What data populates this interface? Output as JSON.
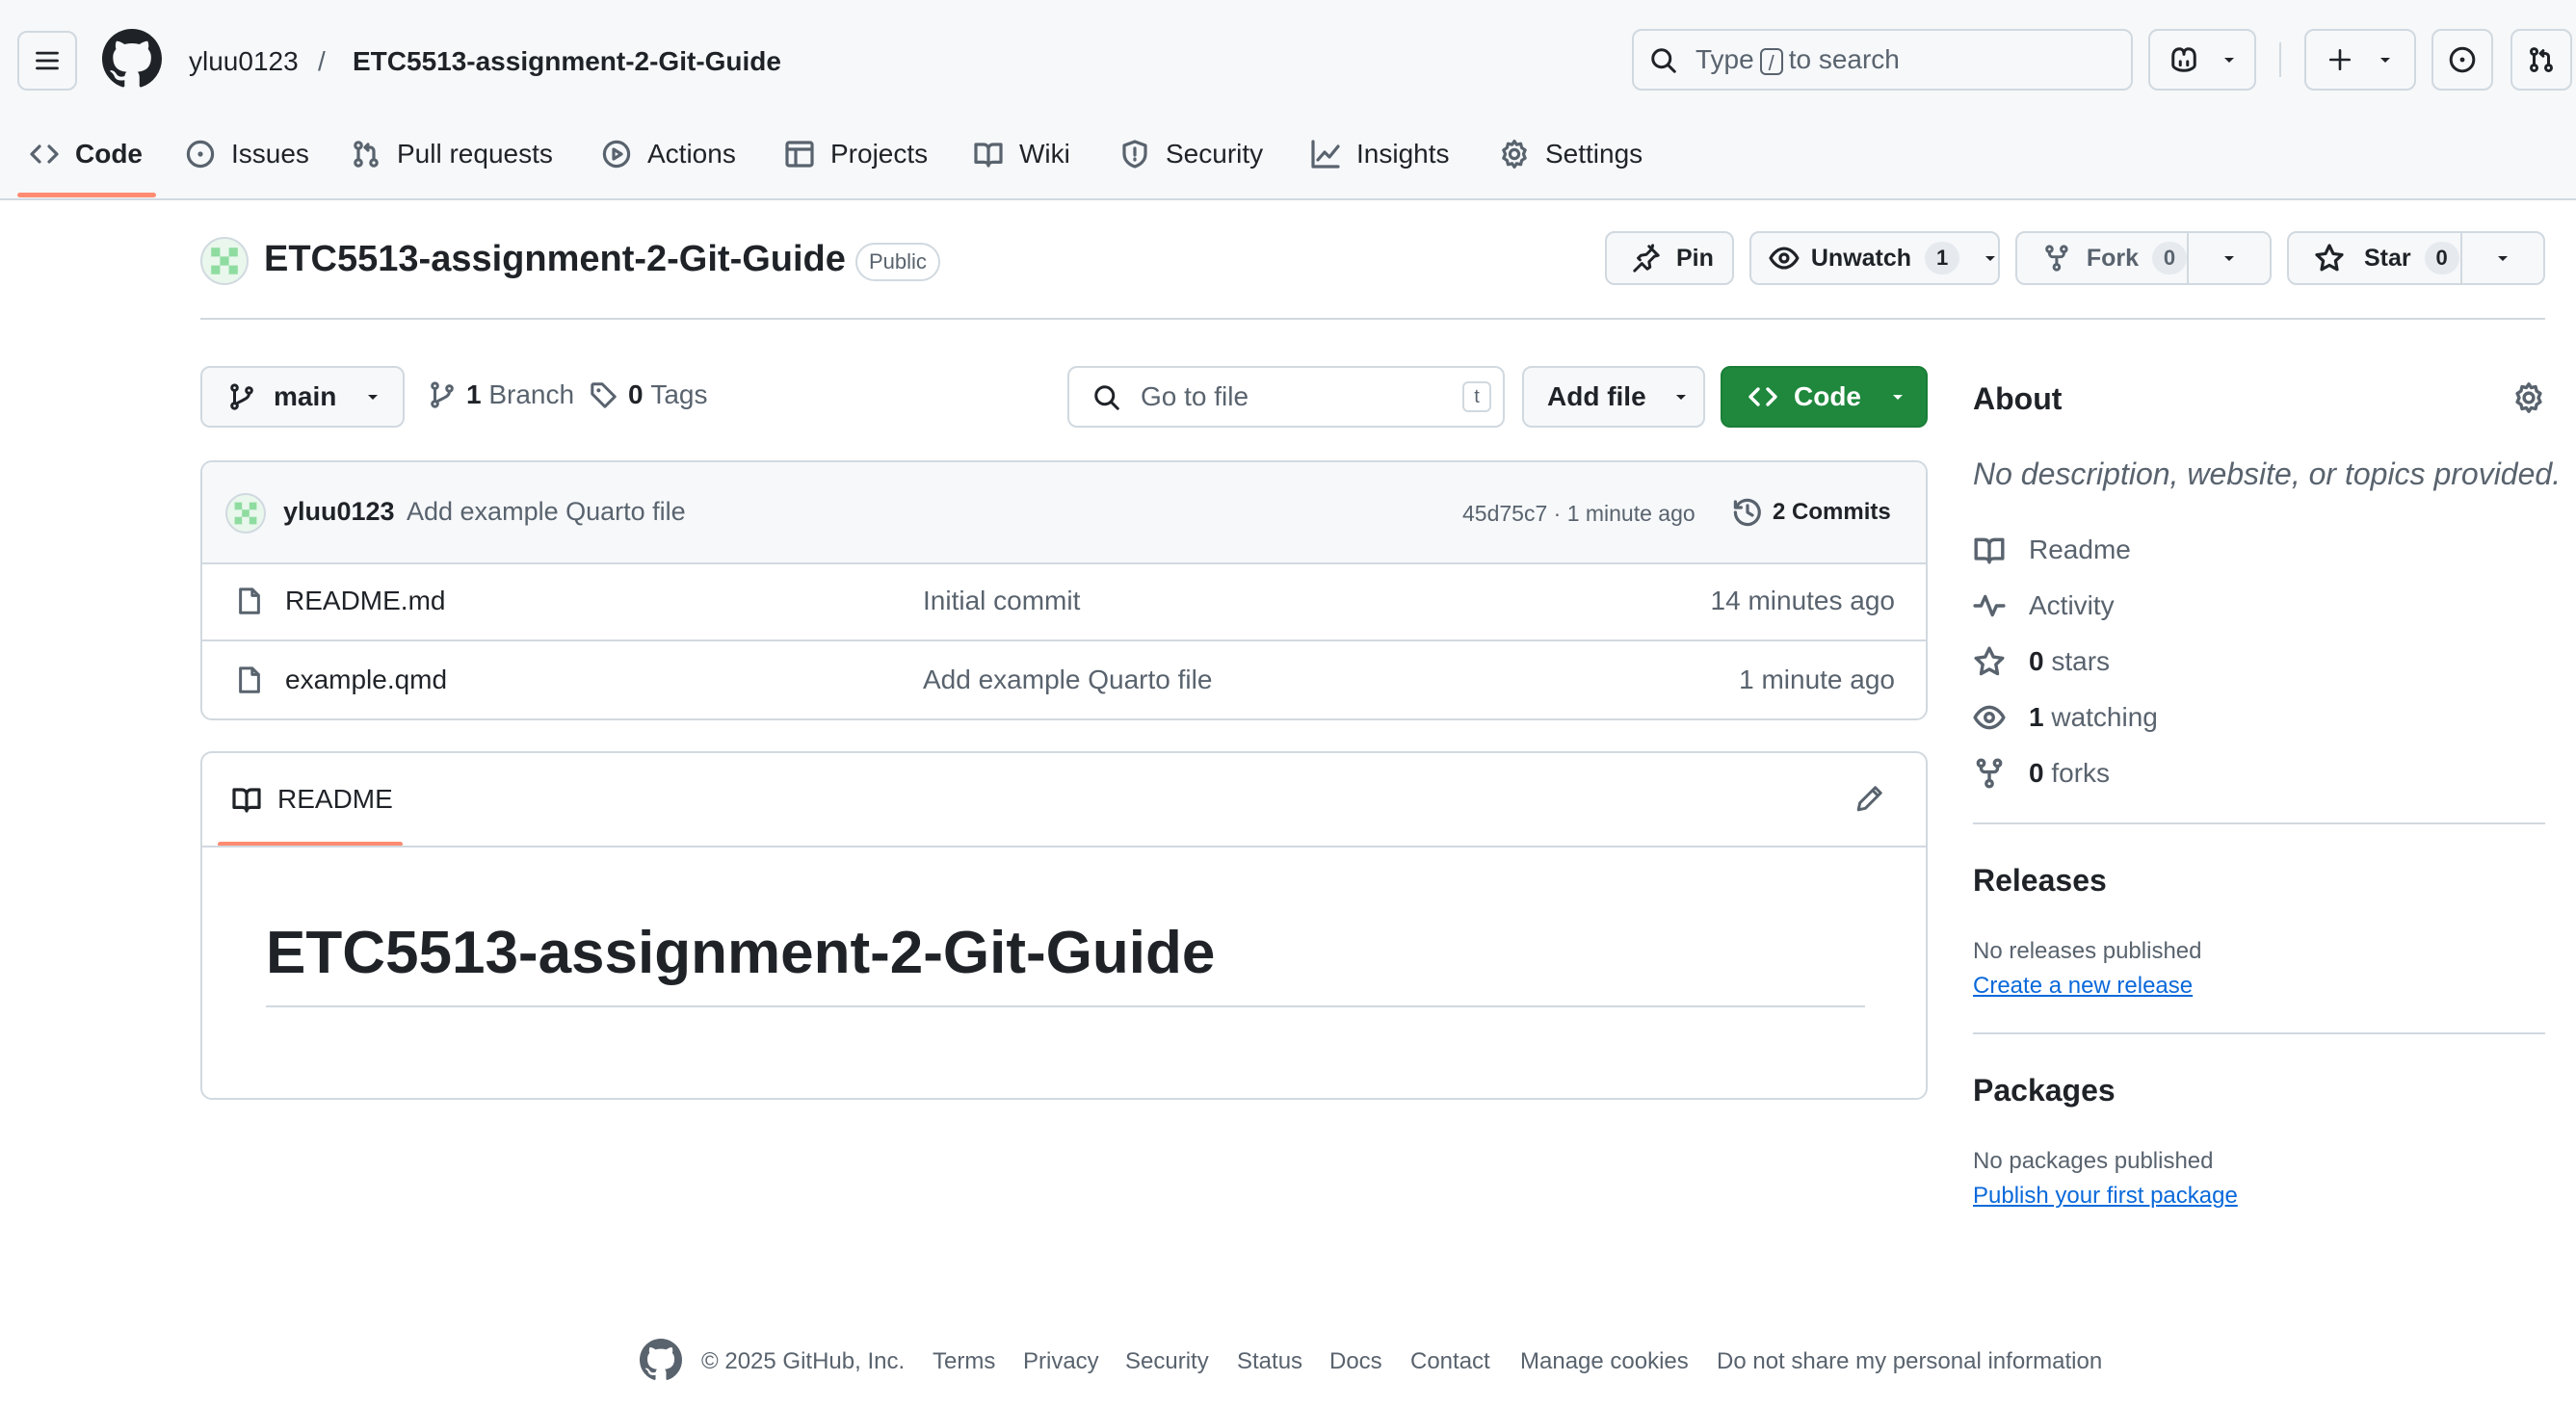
{
  "header": {
    "owner": "yluu0123",
    "separator": "/",
    "repo": "ETC5513-assignment-2-Git-Guide",
    "search": {
      "prefix": "Type",
      "key": "/",
      "suffix": "to search"
    }
  },
  "tabs": [
    {
      "label": "Code",
      "icon": "code-icon"
    },
    {
      "label": "Issues",
      "icon": "issue-icon"
    },
    {
      "label": "Pull requests",
      "icon": "pull-request-icon"
    },
    {
      "label": "Actions",
      "icon": "play-icon"
    },
    {
      "label": "Projects",
      "icon": "table-icon"
    },
    {
      "label": "Wiki",
      "icon": "book-icon"
    },
    {
      "label": "Security",
      "icon": "shield-icon"
    },
    {
      "label": "Insights",
      "icon": "graph-icon"
    },
    {
      "label": "Settings",
      "icon": "gear-icon"
    }
  ],
  "repo": {
    "name": "ETC5513-assignment-2-Git-Guide",
    "visibility": "Public",
    "pin_label": "Pin",
    "watch_label": "Unwatch",
    "watch_count": "1",
    "fork_label": "Fork",
    "fork_count": "0",
    "star_label": "Star",
    "star_count": "0"
  },
  "toolbar": {
    "branch": "main",
    "branches_count": "1",
    "branches_label": "Branch",
    "tags_count": "0",
    "tags_label": "Tags",
    "goto_placeholder": "Go to file",
    "goto_key": "t",
    "add_file_label": "Add file",
    "code_label": "Code"
  },
  "latest_commit": {
    "author": "yluu0123",
    "message": "Add example Quarto file",
    "meta": "45d75c7 · 1 minute ago",
    "commits_count": "2",
    "commits_label": "Commits"
  },
  "files": [
    {
      "name": "README.md",
      "message": "Initial commit",
      "age": "14 minutes ago"
    },
    {
      "name": "example.qmd",
      "message": "Add example Quarto file",
      "age": "1 minute ago"
    }
  ],
  "readme": {
    "tab_label": "README",
    "heading": "ETC5513-assignment-2-Git-Guide"
  },
  "about": {
    "title": "About",
    "description": "No description, website, or topics provided.",
    "readme": "Readme",
    "activity": "Activity",
    "stars_count": "0",
    "stars_label": "stars",
    "watching_count": "1",
    "watching_label": "watching",
    "forks_count": "0",
    "forks_label": "forks"
  },
  "releases": {
    "title": "Releases",
    "empty": "No releases published",
    "link": "Create a new release"
  },
  "packages": {
    "title": "Packages",
    "empty": "No packages published",
    "link": "Publish your first package"
  },
  "footer": {
    "copyright": "© 2025 GitHub, Inc.",
    "links": [
      "Terms",
      "Privacy",
      "Security",
      "Status",
      "Docs",
      "Contact",
      "Manage cookies",
      "Do not share my personal information"
    ]
  },
  "colors": {
    "accent_green": "#1f883d",
    "link_blue": "#0969da",
    "tab_underline": "#fd8c73"
  }
}
